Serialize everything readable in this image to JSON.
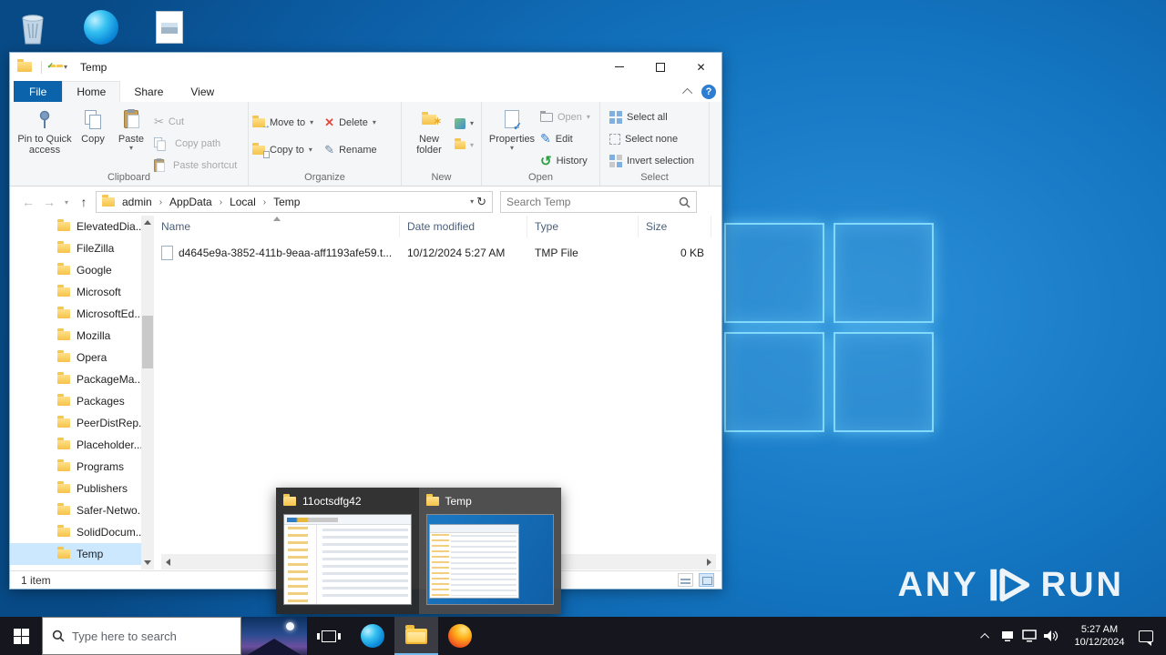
{
  "colors": {
    "accent_blue": "#0b63ab",
    "selection_blue": "#cce8ff",
    "desktop_blue": "#1374c0",
    "taskbar_dark": "#16161f",
    "folder_yellow": "#ffd564"
  },
  "window": {
    "title": "Temp",
    "tabs": [
      "File",
      "Home",
      "Share",
      "View"
    ],
    "ribbon": {
      "clipboard": {
        "label": "Clipboard",
        "pin_to_quick_access": "Pin to Quick access",
        "copy": "Copy",
        "paste": "Paste",
        "cut": "Cut",
        "copy_path": "Copy path",
        "paste_shortcut": "Paste shortcut"
      },
      "organize": {
        "label": "Organize",
        "move_to": "Move to",
        "copy_to": "Copy to",
        "delete": "Delete",
        "rename": "Rename"
      },
      "new": {
        "label": "New",
        "new_folder": "New folder"
      },
      "open": {
        "label": "Open",
        "properties": "Properties",
        "open": "Open",
        "edit": "Edit",
        "history": "History"
      },
      "select": {
        "label": "Select",
        "select_all": "Select all",
        "select_none": "Select none",
        "invert_selection": "Invert selection"
      }
    },
    "address": {
      "breadcrumbs": [
        "admin",
        "AppData",
        "Local",
        "Temp"
      ],
      "search_placeholder": "Search Temp"
    },
    "tree": {
      "items": [
        "ElevatedDia...",
        "FileZilla",
        "Google",
        "Microsoft",
        "MicrosoftEd...",
        "Mozilla",
        "Opera",
        "PackageMa...",
        "Packages",
        "PeerDistRep...",
        "Placeholder...",
        "Programs",
        "Publishers",
        "Safer-Netwo...",
        "SolidDocum...",
        "Temp"
      ],
      "selected_item": "Temp"
    },
    "list": {
      "columns": [
        "Name",
        "Date modified",
        "Type",
        "Size"
      ],
      "rows": [
        {
          "name": "d4645e9a-3852-411b-9eaa-aff1193afe59.t...",
          "date_modified": "10/12/2024 5:27 AM",
          "type": "TMP File",
          "size": "0 KB"
        }
      ]
    },
    "status": {
      "items_count": "1 item"
    }
  },
  "taskbar_preview": {
    "windows": [
      {
        "title": "11octsdfg42"
      },
      {
        "title": "Temp"
      }
    ]
  },
  "taskbar": {
    "search_placeholder": "Type here to search",
    "clock_time": "5:27 AM",
    "clock_date": "10/12/2024"
  },
  "watermark": {
    "any": "ANY",
    "run": "RUN"
  }
}
